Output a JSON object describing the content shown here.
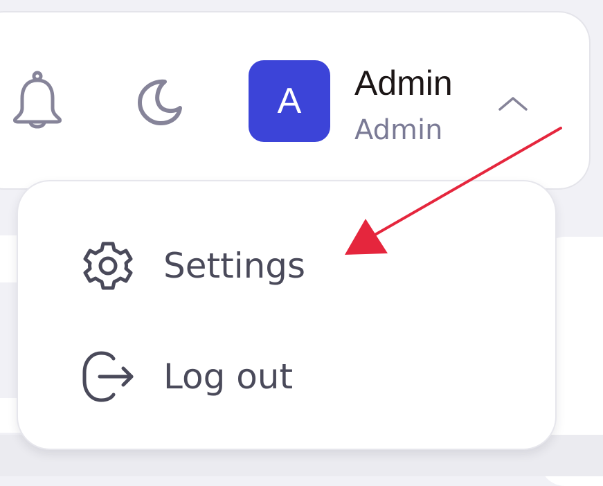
{
  "header": {
    "notifications_icon": "bell-icon",
    "theme_icon": "moon-icon",
    "user": {
      "avatar_initial": "A",
      "avatar_color": "#3c44d8",
      "name": "Admin",
      "role": "Admin",
      "menu_state_icon": "chevron-up-icon"
    }
  },
  "user_menu": {
    "items": [
      {
        "label": "Settings",
        "icon": "gear-icon"
      },
      {
        "label": "Log out",
        "icon": "logout-icon"
      }
    ]
  },
  "annotation": {
    "arrow_color": "#e5263d"
  }
}
